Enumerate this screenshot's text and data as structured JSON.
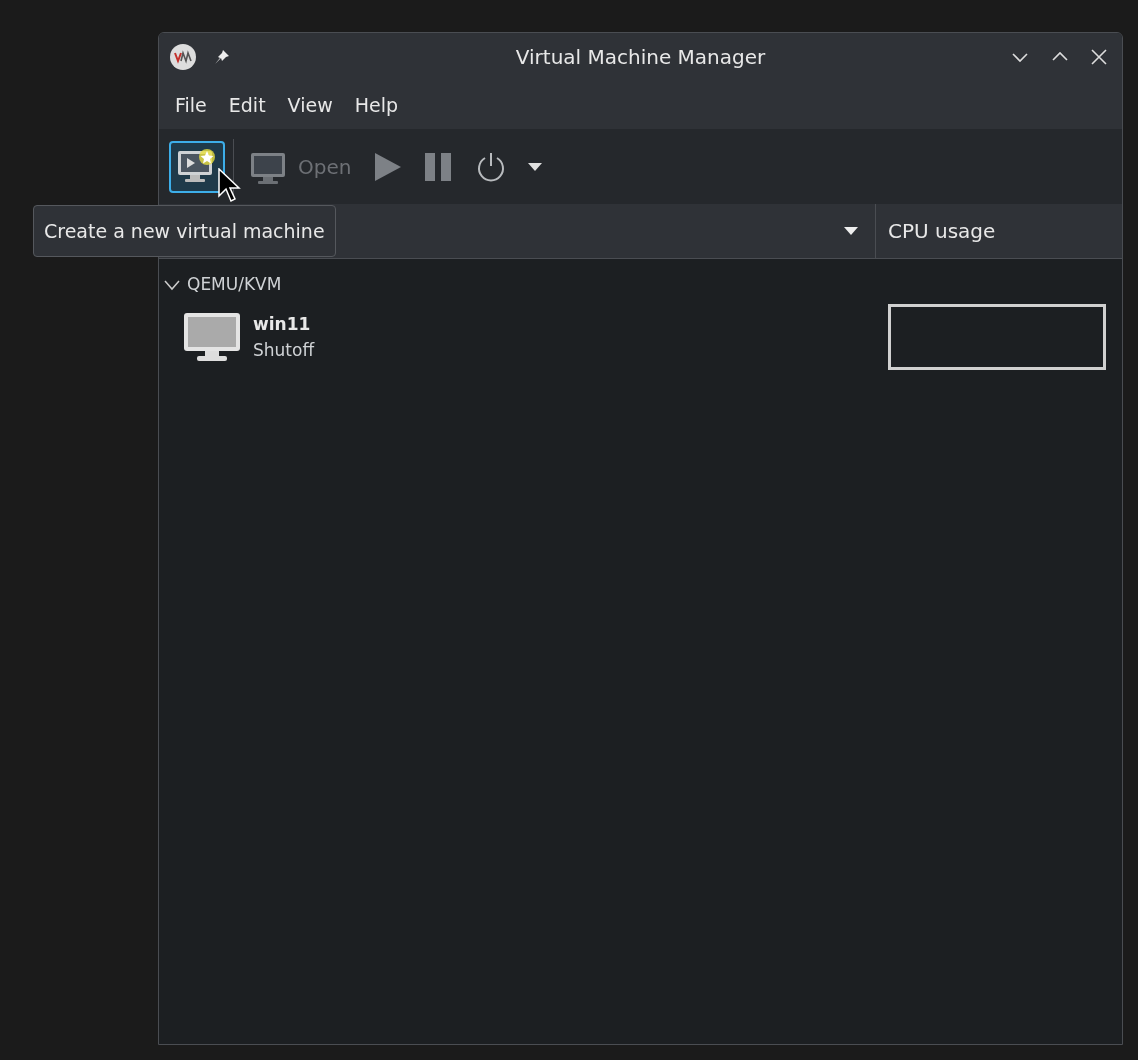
{
  "window": {
    "title": "Virtual Machine Manager"
  },
  "menu": [
    "File",
    "Edit",
    "View",
    "Help"
  ],
  "toolbar": [
    {
      "kind": "new",
      "disabled": false,
      "hovered": true
    },
    {
      "kind": "separator"
    },
    {
      "kind": "open",
      "label": "Open",
      "disabled": true,
      "hovered": false
    },
    {
      "kind": "run",
      "disabled": true,
      "hovered": false
    },
    {
      "kind": "pause",
      "disabled": true,
      "hovered": false
    },
    {
      "kind": "shutdown",
      "disabled": false,
      "hovered": false
    },
    {
      "kind": "menu",
      "disabled": false,
      "hovered": false
    }
  ],
  "tooltip": "Create a new virtual machine",
  "columns": [
    "CPU usage"
  ],
  "connections": [
    {
      "label": "QEMU/KVM",
      "expanded": true,
      "vms": [
        {
          "name": "win11",
          "status": "Shutoff"
        }
      ]
    }
  ]
}
